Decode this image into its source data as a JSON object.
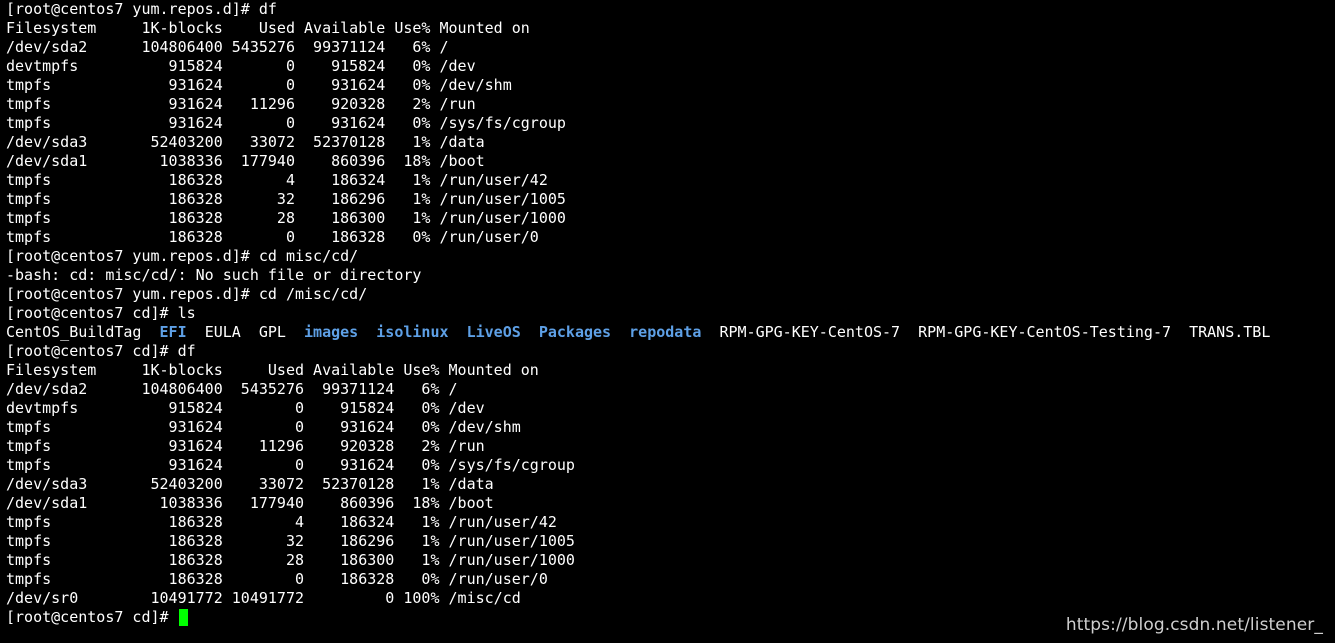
{
  "terminal": {
    "lines_before_ls": [
      "[root@centos7 yum.repos.d]# df",
      "Filesystem     1K-blocks    Used Available Use% Mounted on",
      "/dev/sda2      104806400 5435276  99371124   6% /",
      "devtmpfs          915824       0    915824   0% /dev",
      "tmpfs             931624       0    931624   0% /dev/shm",
      "tmpfs             931624   11296    920328   2% /run",
      "tmpfs             931624       0    931624   0% /sys/fs/cgroup",
      "/dev/sda3       52403200   33072  52370128   1% /data",
      "/dev/sda1        1038336  177940    860396  18% /boot",
      "tmpfs             186328       4    186324   1% /run/user/42",
      "tmpfs             186328      32    186296   1% /run/user/1005",
      "tmpfs             186328      28    186300   1% /run/user/1000",
      "tmpfs             186328       0    186328   0% /run/user/0",
      "[root@centos7 yum.repos.d]# cd misc/cd/",
      "-bash: cd: misc/cd/: No such file or directory",
      "[root@centos7 yum.repos.d]# cd /misc/cd/",
      "[root@centos7 cd]# ls"
    ],
    "ls_output": [
      {
        "name": "CentOS_BuildTag",
        "type": "file"
      },
      {
        "name": "EFI",
        "type": "dir"
      },
      {
        "name": "EULA",
        "type": "file"
      },
      {
        "name": "GPL",
        "type": "file"
      },
      {
        "name": "images",
        "type": "dir"
      },
      {
        "name": "isolinux",
        "type": "dir"
      },
      {
        "name": "LiveOS",
        "type": "dir"
      },
      {
        "name": "Packages",
        "type": "dir"
      },
      {
        "name": "repodata",
        "type": "dir"
      },
      {
        "name": "RPM-GPG-KEY-CentOS-7",
        "type": "file"
      },
      {
        "name": "RPM-GPG-KEY-CentOS-Testing-7",
        "type": "file"
      },
      {
        "name": "TRANS.TBL",
        "type": "file"
      }
    ],
    "lines_after_ls": [
      "[root@centos7 cd]# df",
      "Filesystem     1K-blocks     Used Available Use% Mounted on",
      "/dev/sda2      104806400  5435276  99371124   6% /",
      "devtmpfs          915824        0    915824   0% /dev",
      "tmpfs             931624        0    931624   0% /dev/shm",
      "tmpfs             931624    11296    920328   2% /run",
      "tmpfs             931624        0    931624   0% /sys/fs/cgroup",
      "/dev/sda3       52403200    33072  52370128   1% /data",
      "/dev/sda1        1038336   177940    860396  18% /boot",
      "tmpfs             186328        4    186324   1% /run/user/42",
      "tmpfs             186328       32    186296   1% /run/user/1005",
      "tmpfs             186328       28    186300   1% /run/user/1000",
      "tmpfs             186328        0    186328   0% /run/user/0",
      "/dev/sr0        10491772 10491772         0 100% /misc/cd"
    ],
    "prompt": "[root@centos7 cd]# ",
    "colors": {
      "background": "#000000",
      "text": "#ffffff",
      "directory": "#5ea0e6",
      "cursor": "#00ff00"
    }
  },
  "watermark": "https://blog.csdn.net/listener_"
}
